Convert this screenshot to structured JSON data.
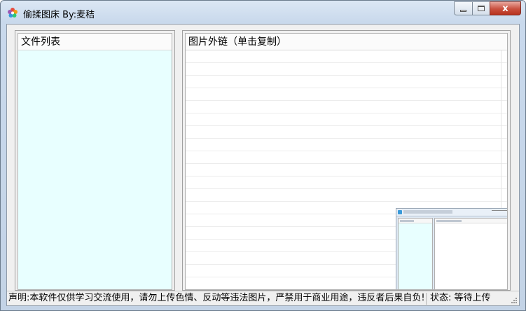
{
  "window": {
    "title": "偷揉图床  By:麦秸",
    "close_glyph": "x"
  },
  "left_panel": {
    "header": "文件列表"
  },
  "right_panel": {
    "header": "图片外链（单击复制）"
  },
  "statusbar": {
    "disclaimer": "声明:本软件仅供学习交流使用，请勿上传色情、反动等违法图片，严禁用于商业用途，违反者后果自负!",
    "status": "状态: 等待上传"
  },
  "colors": {
    "list_background": "#e8ffff",
    "close_button": "#c9503f"
  }
}
